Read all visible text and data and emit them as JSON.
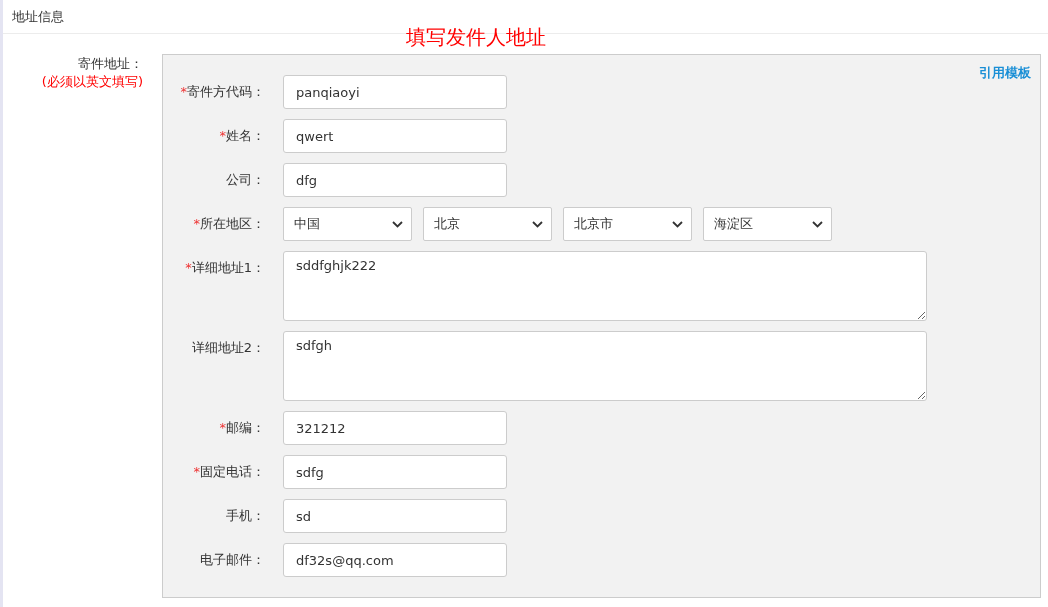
{
  "section_title": "地址信息",
  "annotation": "填写发件人地址",
  "sender_label": "寄件地址：",
  "sender_note": "(必须以英文填写)",
  "template_link": "引用模板",
  "fields": [
    {
      "kind": "input",
      "mark": "*",
      "label": "寄件方代码：",
      "value": "panqiaoyi"
    },
    {
      "kind": "input",
      "mark": "*",
      "label": "姓名：",
      "value": "qwert"
    },
    {
      "kind": "input",
      "label": "公司：",
      "value": "dfg"
    },
    {
      "kind": "select",
      "mark": "*",
      "label": "所在地区：",
      "values": [
        "中国",
        "北京",
        "北京市",
        "海淀区"
      ]
    },
    {
      "kind": "textarea",
      "mark": "*",
      "label": "详细地址1：",
      "value": "sddfghjk222"
    },
    {
      "kind": "textarea",
      "label": "详细地址2：",
      "value": "sdfgh"
    },
    {
      "kind": "input",
      "mark": "*",
      "label": "邮编：",
      "value": "321212"
    },
    {
      "kind": "input",
      "mark": "*",
      "label": "固定电话：",
      "value": "sdfg"
    },
    {
      "kind": "input",
      "label": "手机：",
      "value": "sd"
    },
    {
      "kind": "input",
      "label": "电子邮件：",
      "value": "df32s@qq.com"
    }
  ]
}
